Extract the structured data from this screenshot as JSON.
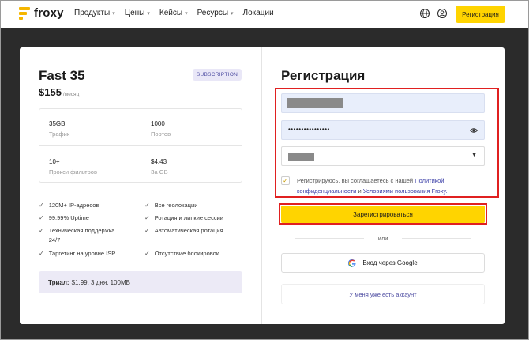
{
  "header": {
    "logo_text": "froxy",
    "nav": [
      {
        "label": "Продукты",
        "has_menu": true
      },
      {
        "label": "Цены",
        "has_menu": true
      },
      {
        "label": "Кейсы",
        "has_menu": true
      },
      {
        "label": "Ресурсы",
        "has_menu": true
      },
      {
        "label": "Локации",
        "has_menu": false
      }
    ],
    "register_label": "Регистрация"
  },
  "plan": {
    "title": "Fast 35",
    "badge": "SUBSCRIPTION",
    "price": "$155",
    "price_period": "/месяц",
    "stats": [
      {
        "value": "35GB",
        "label": "Трафик"
      },
      {
        "value": "1000",
        "label": "Портов"
      },
      {
        "value": "10+",
        "label": "Прокси фильтров"
      },
      {
        "value": "$4.43",
        "label": "За GB"
      }
    ],
    "features_left": [
      "120M+ IP-адресов",
      "99.99% Uptime",
      "Техническая поддержка 24/7",
      "Таргетинг на уровне ISP"
    ],
    "features_right": [
      "Все геолокации",
      "Ротация и липкие сессии",
      "Автоматическая ротация",
      "Отсутствие блокировок"
    ],
    "trial_label": "Триал:",
    "trial_value": "$1.99, 3 дня, 100MB"
  },
  "form": {
    "title": "Регистрация",
    "password_value": "••••••••••••••••",
    "consent_text": "Регистрируюсь, вы соглашаетесь с нашей",
    "consent_link_privacy": "Политикой конфиденциальности",
    "consent_and": "и",
    "consent_link_terms": "Условиями пользования Froxy.",
    "consent_checked": true,
    "submit_label": "Зарегистрироваться",
    "or_label": "или",
    "google_label": "Вход через Google",
    "have_account_label": "У меня уже есть аккаунт"
  },
  "colors": {
    "accent": "#ffd400",
    "brand_logo": "#f5b600",
    "link": "#3b3fa8",
    "highlight_box": "#e02020",
    "field_fill": "#e8eefb"
  },
  "icons": [
    "froxy-logo-icon",
    "chevron-down-icon",
    "globe-icon",
    "user-icon",
    "check-icon",
    "eye-icon",
    "caret-down-icon",
    "google-icon",
    "checkbox-check-icon"
  ]
}
